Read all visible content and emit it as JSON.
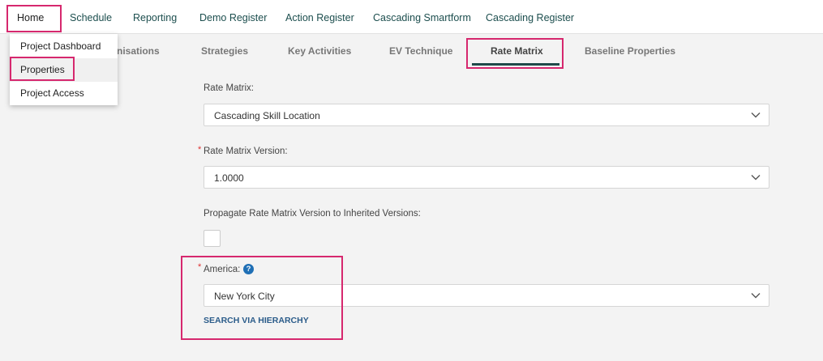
{
  "topnav": {
    "home": "Home",
    "items": [
      "Schedule",
      "Reporting",
      "Demo Register",
      "Action Register",
      "Cascading Smartform",
      "Cascading Register"
    ]
  },
  "home_menu": {
    "items": [
      "Project Dashboard",
      "Properties",
      "Project Access"
    ],
    "selected": "Properties"
  },
  "subtabs": {
    "items": [
      "nisations",
      "Strategies",
      "Key Activities",
      "EV Technique",
      "Rate Matrix",
      "Baseline Properties"
    ],
    "active": "Rate Matrix"
  },
  "form": {
    "rate_matrix_label": "Rate Matrix:",
    "rate_matrix_value": "Cascading Skill Location",
    "version_label": "Rate Matrix Version:",
    "version_value": "1.0000",
    "propagate_label": "Propagate Rate Matrix Version to Inherited Versions:",
    "propagate_checked": false,
    "america_label": "America:",
    "america_value": "New York City",
    "search_link": "SEARCH VIA HIERARCHY",
    "required_marker": "*"
  },
  "icons": {
    "help": "?",
    "chevron": "chevron-down-icon"
  },
  "colors": {
    "highlight": "#d6286e",
    "nav_text": "#1c4e4e",
    "link": "#2b5c8a",
    "help_icon": "#1f6fb5",
    "required": "#dd3333"
  }
}
